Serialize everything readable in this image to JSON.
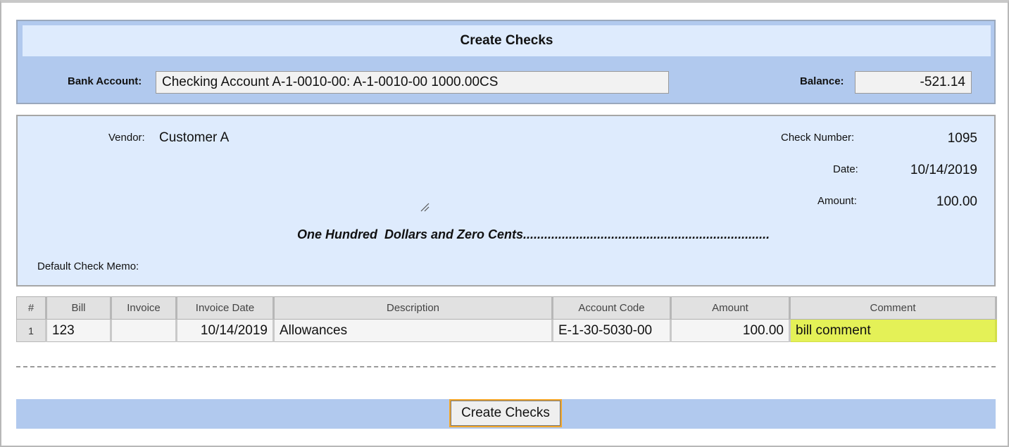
{
  "header": {
    "title": "Create Checks",
    "bank_account_label": "Bank Account:",
    "bank_account_value": "Checking Account A-1-0010-00: A-1-0010-00 1000.00CS",
    "balance_label": "Balance:",
    "balance_value": "-521.14"
  },
  "check": {
    "vendor_label": "Vendor:",
    "vendor_value": "Customer A",
    "check_number_label": "Check Number:",
    "check_number_value": "1095",
    "date_label": "Date:",
    "date_value": "10/14/2019",
    "amount_label": "Amount:",
    "amount_value": "100.00",
    "amount_words": "One Hundred  Dollars and Zero Cents......................................................................",
    "memo_label": "Default Check Memo:"
  },
  "table": {
    "columns": [
      "#",
      "Bill",
      "Invoice",
      "Invoice Date",
      "Description",
      "Account Code",
      "Amount",
      "Comment"
    ],
    "rows": [
      {
        "num": "1",
        "bill": "123",
        "invoice": "",
        "invoice_date": "10/14/2019",
        "description": "Allowances",
        "account_code": "E-1-30-5030-00",
        "amount": "100.00",
        "comment": "bill comment"
      }
    ]
  },
  "footer": {
    "create_button_label": "Create Checks"
  },
  "colors": {
    "panel_blue": "#b1c9ee",
    "light_blue": "#deebfd",
    "comment_highlight": "#e4f157",
    "button_focus": "#f2a62a"
  }
}
